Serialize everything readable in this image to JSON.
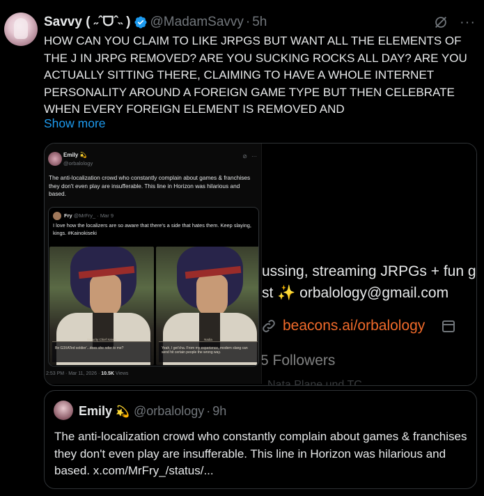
{
  "post": {
    "display_name": "Savvy ( ˶ˆᗜˆ˵ )",
    "handle": "@MadamSavvy",
    "separator": "·",
    "time": "5h",
    "more_icon": "···",
    "text": "HOW CAN YOU CLAIM TO LIKE JRPGS BUT WANT ALL THE ELEMENTS OF THE J IN JRPG REMOVED? ARE YOU SUCKING ROCKS ALL DAY? ARE YOU ACTUALLY SITTING THERE, CLAIMING TO HAVE A WHOLE INTERNET PERSONALITY AROUND A FOREIGN GAME TYPE BUT THEN CELEBRATE WHEN EVERY FOREIGN ELEMENT IS REMOVED AND",
    "show_more": "Show more",
    "accent_color": "#1d9bf0"
  },
  "media": {
    "background": {
      "line1": "ussing, streaming JRPGs + fun g",
      "line2_prefix": "st ✨ orbalology@gmail.com",
      "link": "beacons.ai/orbalology",
      "followers": "5 Followers",
      "cut_text": "Nata Plane und TC",
      "link_color": "#f06a2a"
    },
    "screenshot": {
      "name": "Emily 💫",
      "handle": "@orbalology",
      "more_icon": "···",
      "text": "The anti-localization crowd who constantly complain about games & franchises they don't even play are insufferable. This line in Horizon was hilarious and based.",
      "quoted": {
        "name": "Fry",
        "handle": "@MrFry_",
        "separator": "·",
        "date": "Mar 9",
        "text": "I love how the localizers are so aware that there's a side that hates them. Keep slaying, kings. #Kainokiseki",
        "left_caption_name": "Security Chief Xaiver",
        "left_caption_text": "Be G3XATed soldier'...does she refer to me?",
        "right_caption_name": "Nadia",
        "right_caption_text": "Yeah, I get'cha. From my experience, modern slang can send hit certain people the wrong way."
      },
      "footer_time": "2:53 PM · Mar 11, 2026 · ",
      "footer_views": "10.5K",
      "footer_views_label": " Views"
    }
  },
  "quote": {
    "name": "Emily",
    "emoji": "💫",
    "handle": "@orbalology",
    "separator": "·",
    "time": "9h",
    "text": "The anti-localization crowd who constantly complain about games & franchises they don't even play are insufferable. This line in Horizon was hilarious and based. x.com/MrFry_/status/..."
  }
}
